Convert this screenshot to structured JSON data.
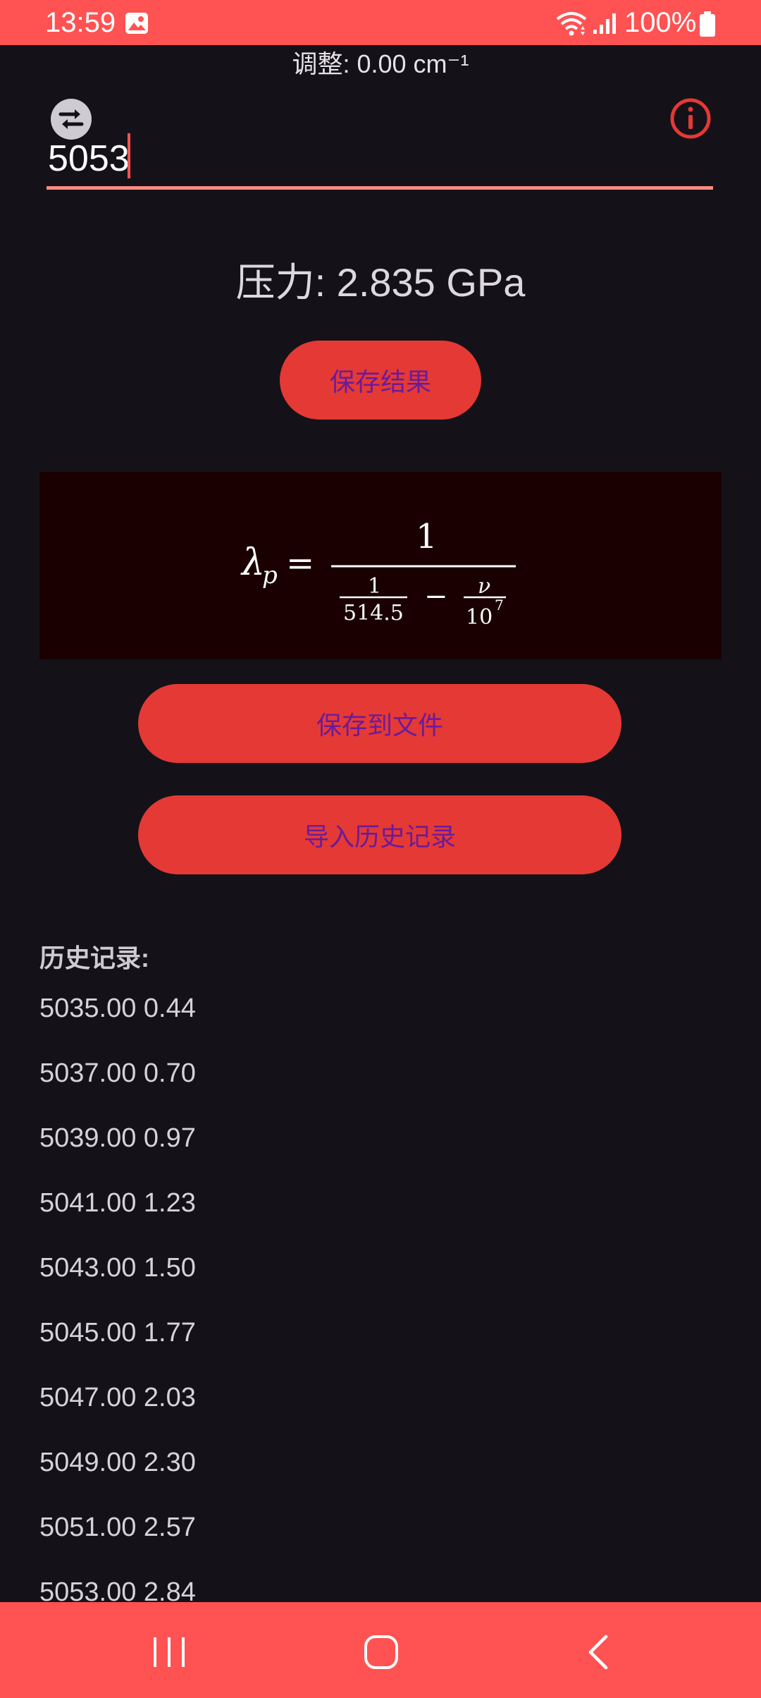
{
  "status_bar": {
    "time": "13:59",
    "battery": "100%"
  },
  "header": {
    "adjustment": "调整: 0.00 cm⁻¹"
  },
  "input": {
    "value": "5053"
  },
  "result": {
    "pressure": "压力: 2.835 GPa"
  },
  "buttons": {
    "save_result": "保存结果",
    "save_to_file": "保存到文件",
    "import_history": "导入历史记录"
  },
  "formula": {
    "lhs_symbol": "λ",
    "lhs_subscript": "p",
    "equals": "=",
    "numerator": "1",
    "inner_numerator": "1",
    "inner_denominator": "514.5",
    "minus": "−",
    "nu": "ν",
    "ten": "10",
    "exponent": "7"
  },
  "history": {
    "title": "历史记录:",
    "items": [
      "5035.00 0.44",
      "5037.00 0.70",
      "5039.00 0.97",
      "5041.00 1.23",
      "5043.00 1.50",
      "5045.00 1.77",
      "5047.00 2.03",
      "5049.00 2.30",
      "5051.00 2.57",
      "5053.00 2.84"
    ]
  },
  "colors": {
    "accent": "#ff5252",
    "button": "#e53935",
    "button_text": "#6a1b9a",
    "background": "#141218",
    "formula_bg": "#1a0000"
  }
}
